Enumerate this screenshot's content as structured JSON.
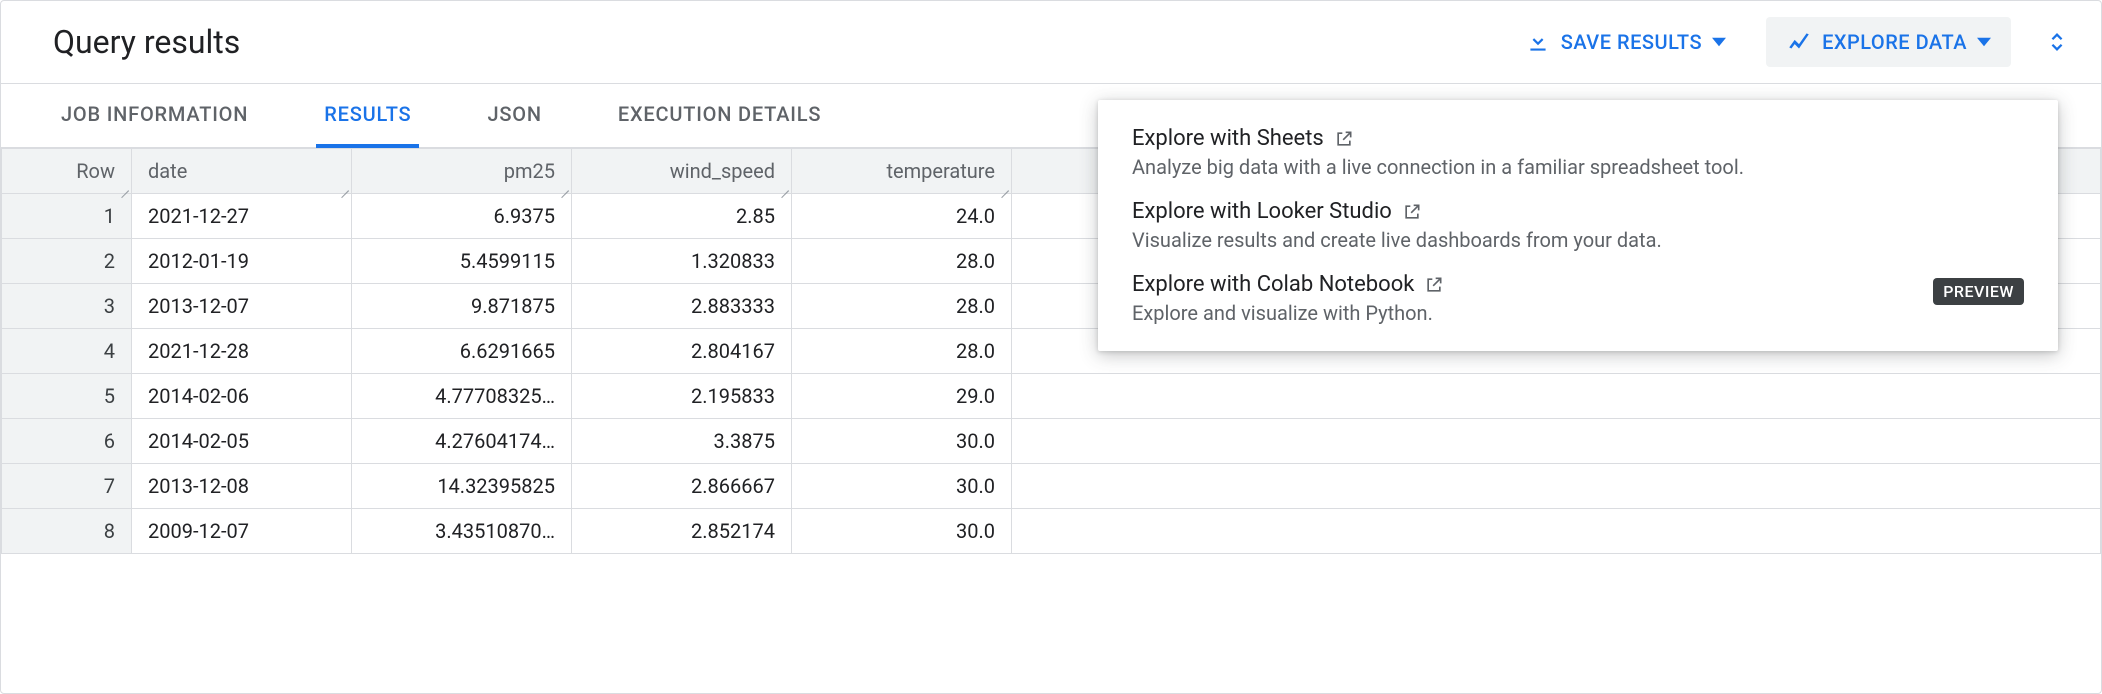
{
  "header": {
    "title": "Query results",
    "save_label": "SAVE RESULTS",
    "explore_label": "EXPLORE DATA"
  },
  "tabs": [
    {
      "id": "job",
      "label": "JOB INFORMATION",
      "active": false
    },
    {
      "id": "results",
      "label": "RESULTS",
      "active": true
    },
    {
      "id": "json",
      "label": "JSON",
      "active": false
    },
    {
      "id": "exec",
      "label": "EXECUTION DETAILS",
      "active": false
    }
  ],
  "columns": {
    "row": "Row",
    "date": "date",
    "pm25": "pm25",
    "wind_speed": "wind_speed",
    "temperature": "temperature"
  },
  "rows": [
    {
      "i": "1",
      "date": "2021-12-27",
      "pm25": "6.9375",
      "wind": "2.85",
      "temp": "24.0"
    },
    {
      "i": "2",
      "date": "2012-01-19",
      "pm25": "5.4599115",
      "wind": "1.320833",
      "temp": "28.0"
    },
    {
      "i": "3",
      "date": "2013-12-07",
      "pm25": "9.871875",
      "wind": "2.883333",
      "temp": "28.0"
    },
    {
      "i": "4",
      "date": "2021-12-28",
      "pm25": "6.6291665",
      "wind": "2.804167",
      "temp": "28.0"
    },
    {
      "i": "5",
      "date": "2014-02-06",
      "pm25": "4.77708325…",
      "wind": "2.195833",
      "temp": "29.0"
    },
    {
      "i": "6",
      "date": "2014-02-05",
      "pm25": "4.27604174…",
      "wind": "3.3875",
      "temp": "30.0"
    },
    {
      "i": "7",
      "date": "2013-12-08",
      "pm25": "14.32395825",
      "wind": "2.866667",
      "temp": "30.0"
    },
    {
      "i": "8",
      "date": "2009-12-07",
      "pm25": "3.43510870…",
      "wind": "2.852174",
      "temp": "30.0"
    }
  ],
  "dropdown": {
    "items": [
      {
        "title": "Explore with Sheets",
        "desc": "Analyze big data with a live connection in a familiar spreadsheet tool."
      },
      {
        "title": "Explore with Looker Studio",
        "desc": "Visualize results and create live dashboards from your data."
      },
      {
        "title": "Explore with Colab Notebook",
        "desc": "Explore and visualize with Python.",
        "badge": "PREVIEW"
      }
    ]
  }
}
